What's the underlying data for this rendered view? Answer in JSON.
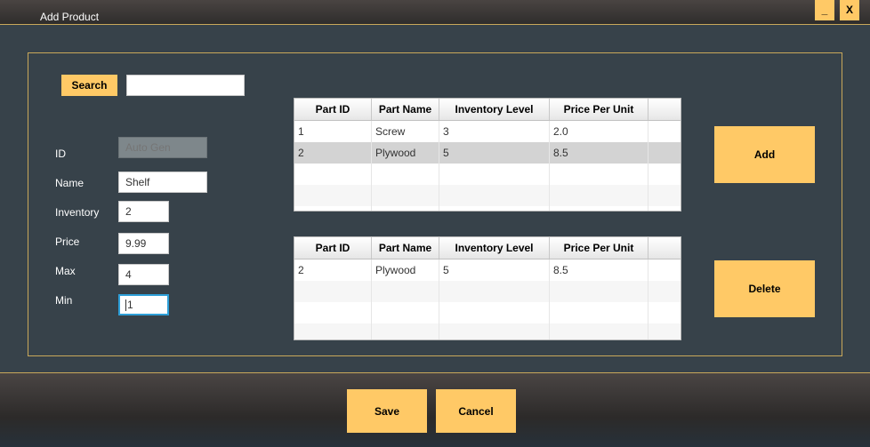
{
  "window": {
    "title": "Add Product",
    "minimize_label": "_",
    "close_label": "X"
  },
  "search": {
    "button_label": "Search",
    "value": ""
  },
  "form": {
    "id": {
      "label": "ID",
      "placeholder": "Auto Gen",
      "value": ""
    },
    "name": {
      "label": "Name",
      "value": "Shelf"
    },
    "inventory": {
      "label": "Inventory",
      "value": "2"
    },
    "price": {
      "label": "Price",
      "value": "9.99"
    },
    "max": {
      "label": "Max",
      "value": "4"
    },
    "min": {
      "label": "Min",
      "value": "1"
    }
  },
  "columns": [
    "Part ID",
    "Part Name",
    "Inventory Level",
    "Price Per Unit"
  ],
  "parts_table": {
    "rows": [
      [
        "1",
        "Screw",
        "3",
        "2.0"
      ],
      [
        "2",
        "Plywood",
        "5",
        "8.5"
      ]
    ],
    "selected_row": 1
  },
  "associated_table": {
    "rows": [
      [
        "2",
        "Plywood",
        "5",
        "8.5"
      ]
    ]
  },
  "actions": {
    "add_label": "Add",
    "delete_label": "Delete",
    "save_label": "Save",
    "cancel_label": "Cancel"
  },
  "colors": {
    "background": "#37424a",
    "accent": "#ffc966",
    "border": "#c9a85a",
    "selection": "#d3d3d3"
  }
}
